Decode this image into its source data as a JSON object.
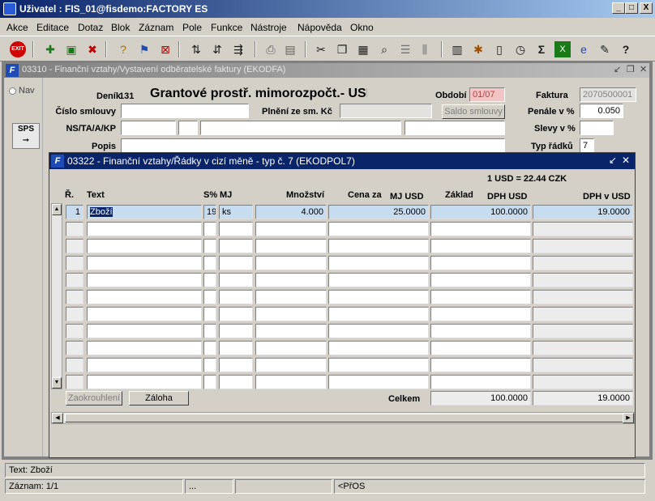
{
  "window": {
    "title": "Uživatel : FIS_01@fisdemo:FACTORY ES",
    "min": "_",
    "max": "□",
    "close": "X"
  },
  "menu": [
    "Akce",
    "Editace",
    "Dotaz",
    "Blok",
    "Záznam",
    "Pole",
    "Funkce",
    "Nástroje",
    "Nápověda",
    "Okno"
  ],
  "toolbar": {
    "exit_label": "EXIT"
  },
  "outer_form": {
    "title": "03310 - Finanční vztahy/Vystavení odběratelské faktury (EKODFA)",
    "nav_label": "Nav",
    "sps_label": "SPS",
    "denik_label": "Deník",
    "denik_value": "131",
    "denik_name": "Grantové prostř. mimorozpočt.- USD",
    "obdobi_label": "Období",
    "obdobi_value": "01/07",
    "faktura_label": "Faktura",
    "faktura_value": "2070500001",
    "cislo_smlouvy_label": "Číslo smlouvy",
    "plneni_label": "Plnění ze sm. Kč",
    "saldo_button": "Saldo smlouvy",
    "penale_label": "Penále v %",
    "penale_value": "0.050",
    "ns_label": "NS/TA/A/KP",
    "slevy_label": "Slevy v %",
    "popis_label": "Popis",
    "typ_radku_label": "Typ řádků",
    "typ_radku_value": "7"
  },
  "inner_form": {
    "title": "03322 - Finanční vztahy/Řádky v cizí měně - typ č. 7 (EKODPOL7)",
    "rate": "1 USD = 22.44 CZK",
    "headers": {
      "r": "Ř.",
      "text": "Text",
      "s": "S%",
      "mj": "MJ",
      "mnozstvi": "Množství",
      "cena_za": "Cena za",
      "mj_usd": "MJ  USD",
      "zaklad": "Základ",
      "dph_usd": "DPH   USD",
      "dph_v_usd": "DPH v   USD"
    },
    "rows": [
      {
        "r": "1",
        "text": "Zboží",
        "s": "19",
        "mj": "ks",
        "mnozstvi": "4.000",
        "cena": "25.0000",
        "zaklad": "100.0000",
        "dph": "19.0000"
      }
    ],
    "zaokrouhleni_button": "Zaokrouhlení",
    "zaloha_button": "Záloha",
    "celkem_label": "Celkem",
    "celkem_zaklad": "100.0000",
    "celkem_dph": "19.0000"
  },
  "status": {
    "hint": "Text: Zboží",
    "record": "Záznam: 1/1",
    "dots": "...",
    "mode": "<PřOS"
  }
}
